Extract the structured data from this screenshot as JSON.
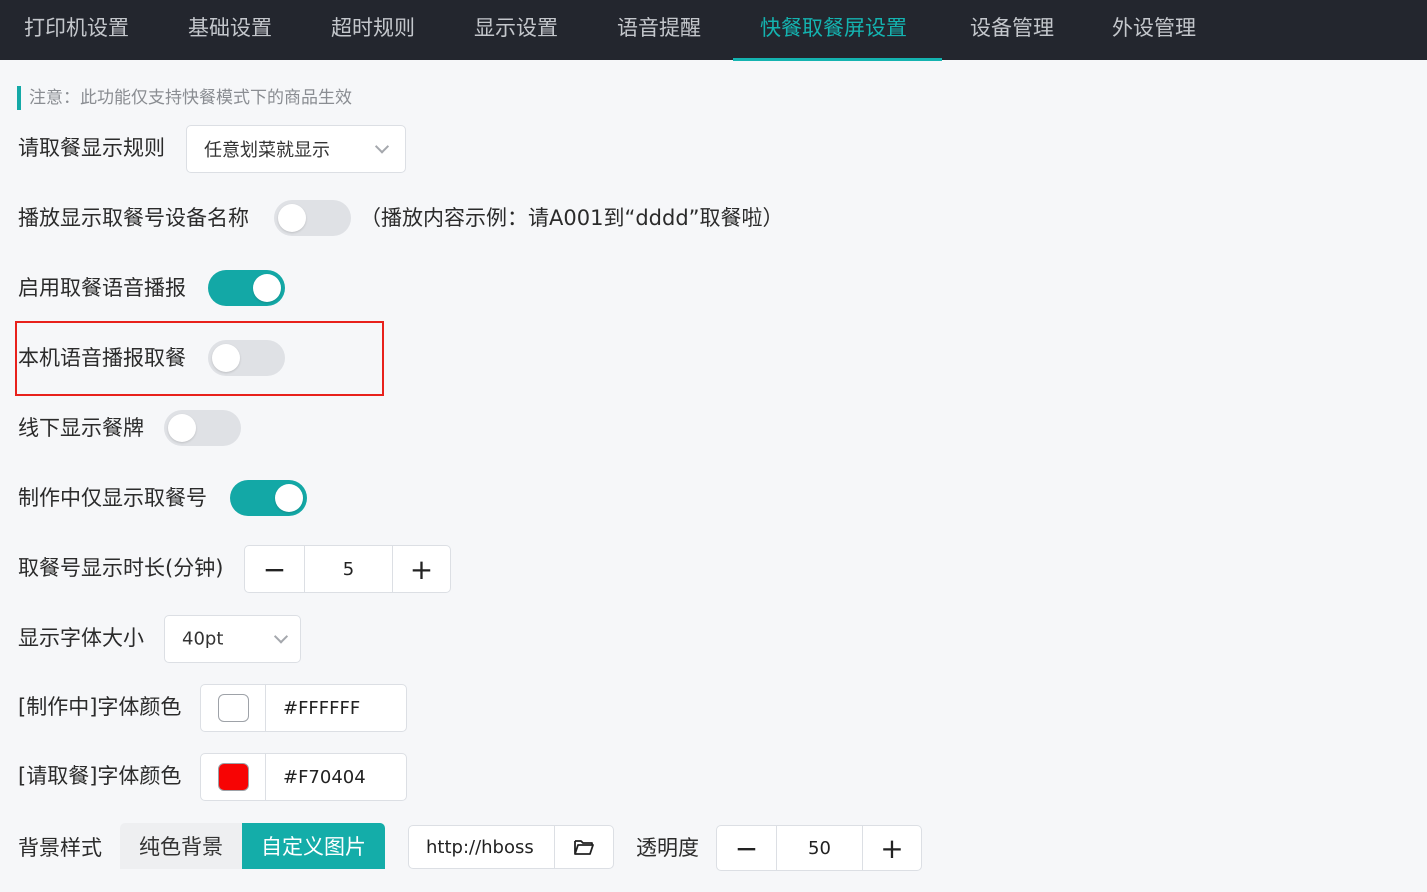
{
  "tabs": [
    {
      "label": "打印机设置",
      "active": false
    },
    {
      "label": "基础设置",
      "active": false
    },
    {
      "label": "超时规则",
      "active": false
    },
    {
      "label": "显示设置",
      "active": false
    },
    {
      "label": "语音提醒",
      "active": false
    },
    {
      "label": "快餐取餐屏设置",
      "active": true
    },
    {
      "label": "设备管理",
      "active": false
    },
    {
      "label": "外设管理",
      "active": false
    }
  ],
  "notice": "注意：此功能仅支持快餐模式下的商品生效",
  "settings": {
    "display_rule": {
      "label": "请取餐显示规则",
      "value": "任意划菜就显示"
    },
    "broadcast_device_name": {
      "label": "播放显示取餐号设备名称",
      "enabled": false,
      "hint": "（播放内容示例：请A001到“dddd”取餐啦）"
    },
    "voice_broadcast": {
      "label": "启用取餐语音播报",
      "enabled": true
    },
    "local_voice": {
      "label": "本机语音播报取餐",
      "enabled": false
    },
    "offline_plate": {
      "label": "线下显示餐牌",
      "enabled": false
    },
    "making_only_number": {
      "label": "制作中仅显示取餐号",
      "enabled": true
    },
    "display_duration": {
      "label": "取餐号显示时长(分钟)",
      "value": "5",
      "minus": "−",
      "plus": "+"
    },
    "font_size": {
      "label": "显示字体大小",
      "value": "40pt"
    },
    "making_color": {
      "label": "[制作中]字体颜色",
      "hex": "#FFFFFF",
      "swatch": "#FFFFFF"
    },
    "pickup_color": {
      "label": "[请取餐]字体颜色",
      "hex": "#F70404",
      "swatch": "#F70404"
    },
    "background": {
      "label": "背景样式",
      "options": [
        "纯色背景",
        "自定义图片"
      ],
      "selected": "自定义图片",
      "url": "http://hboss",
      "opacity_label": "透明度",
      "opacity_value": "50",
      "minus": "−",
      "plus": "+"
    }
  },
  "colors": {
    "accent": "#14B3B0",
    "topbar": "#23262E",
    "highlight": "#E8211C"
  }
}
